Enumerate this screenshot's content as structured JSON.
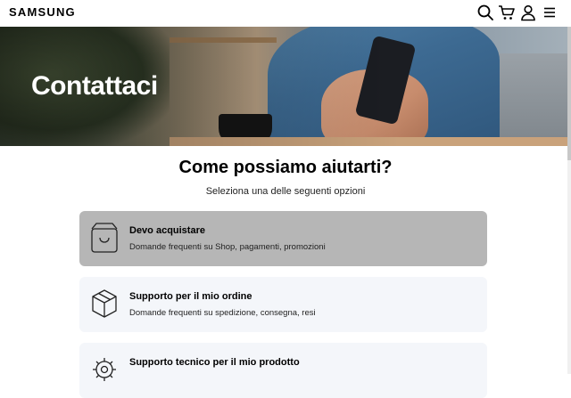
{
  "header": {
    "logo": "SAMSUNG",
    "icons": [
      "search-icon",
      "cart-icon",
      "user-icon",
      "menu-icon"
    ]
  },
  "hero": {
    "title": "Contattaci"
  },
  "main": {
    "title": "Come possiamo aiutarti?",
    "subtitle": "Seleziona una delle seguenti opzioni",
    "options": [
      {
        "title": "Devo acquistare",
        "description": "Domande frequenti su Shop, pagamenti, promozioni",
        "icon": "shopping-bag-icon",
        "state": "hovered"
      },
      {
        "title": "Supporto per il mio ordine",
        "description": "Domande frequenti su spedizione, consegna, resi",
        "icon": "package-box-icon",
        "state": "default"
      },
      {
        "title": "Supporto tecnico per il mio prodotto",
        "description": "",
        "icon": "gear-wrench-icon",
        "state": "default"
      }
    ]
  },
  "colors": {
    "card_default": "#f4f6fa",
    "card_hover": "#b6b6b6",
    "hero_text": "#ffffff"
  }
}
